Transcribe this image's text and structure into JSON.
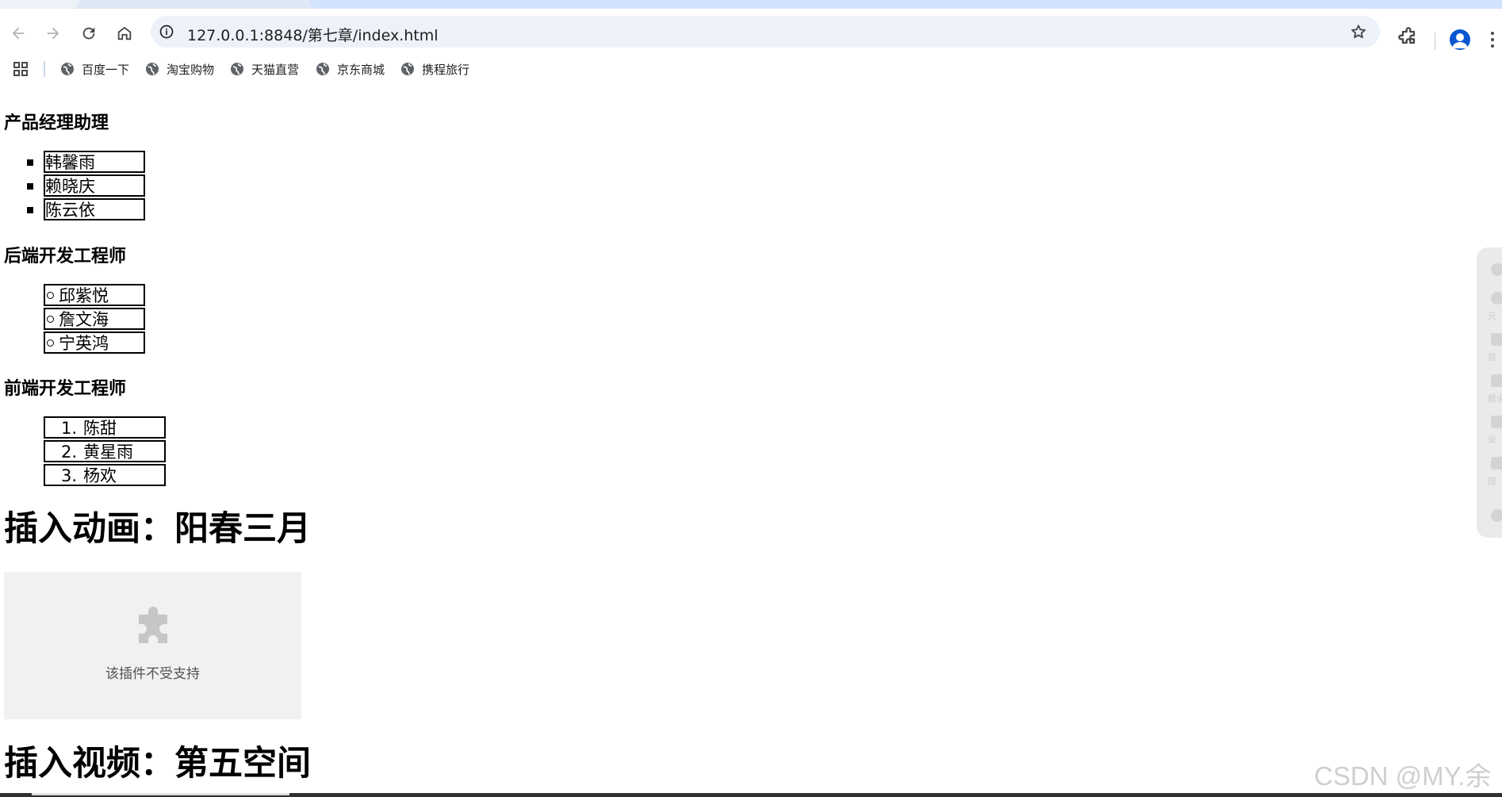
{
  "browser": {
    "url": "127.0.0.1:8848/第七章/index.html",
    "bookmarks": [
      "百度一下",
      "淘宝购物",
      "天猫直营",
      "京东商城",
      "携程旅行"
    ]
  },
  "page": {
    "section1": {
      "title": "产品经理助理",
      "items": [
        "韩馨雨",
        "赖晓庆",
        "陈云依"
      ]
    },
    "section2": {
      "title": "后端开发工程师",
      "items": [
        "邱紫悦",
        "詹文海",
        "宁英鸿"
      ]
    },
    "section3": {
      "title": "前端开发工程师",
      "items": [
        "陈甜",
        "黄星雨",
        "杨欢"
      ],
      "numbers": [
        "1.",
        "2.",
        "3."
      ]
    },
    "animation": {
      "title": "插入动画：阳春三月",
      "plugin_message": "该插件不受支持"
    },
    "video": {
      "title": "插入视频：第五空间"
    }
  },
  "side_panel": {
    "labels": [
      "元",
      "截",
      "截全",
      "录",
      "搜"
    ]
  },
  "watermark": "CSDN @MY.余"
}
